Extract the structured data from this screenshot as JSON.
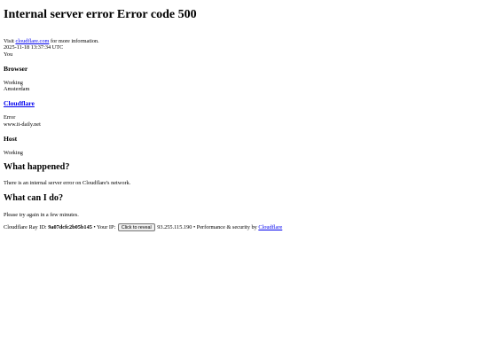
{
  "header": {
    "title": "Internal server error Error code 500"
  },
  "info": {
    "visit_prefix": "Visit ",
    "visit_link": "cloudflare.com",
    "visit_suffix": " for more information.",
    "timestamp": "2025-11-18 13:37:34 UTC",
    "you": "You"
  },
  "browser": {
    "heading": "Browser",
    "status": "Working",
    "location": "Amsterdam"
  },
  "cloudflare": {
    "heading": "Cloudflare",
    "status": "Error",
    "host": "www.it-daily.net"
  },
  "host": {
    "heading": "Host",
    "status": "Working"
  },
  "what_happened": {
    "heading": "What happened?",
    "text": "There is an internal server error on Cloudflare's network."
  },
  "what_can_i_do": {
    "heading": "What can I do?",
    "text": "Please try again in a few minutes."
  },
  "footer": {
    "ray_label": "Cloudflare Ray ID: ",
    "ray_id": "9a07dcfc2b05b145",
    "ip_label": " • Your IP: ",
    "reveal_button": "Click to reveal",
    "ip_value": " 93.255.115.190 • Performance & security by ",
    "cf_link": "Cloudflare"
  }
}
